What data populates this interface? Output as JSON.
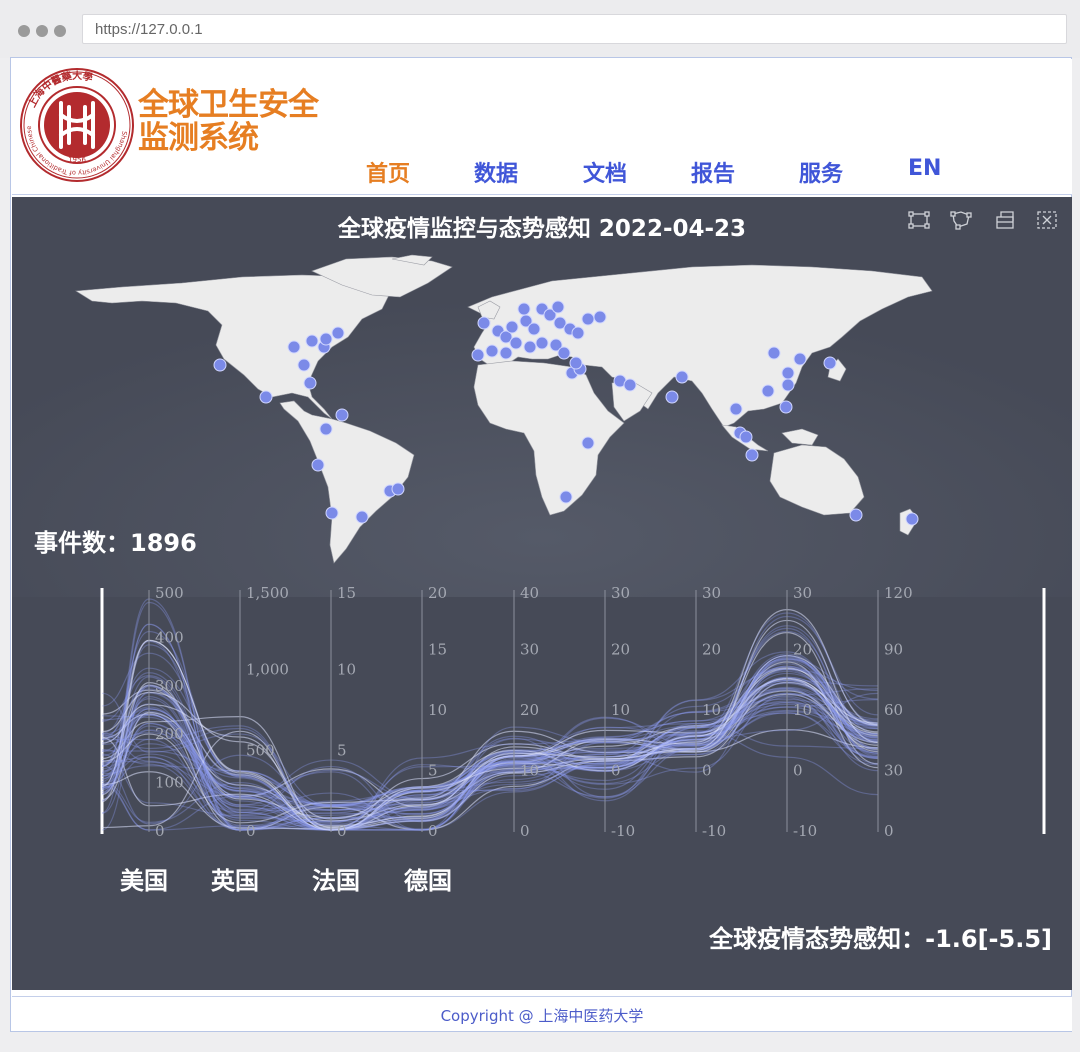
{
  "browser": {
    "url": "https://127.0.0.1"
  },
  "header": {
    "title_line1": "全球卫生安全",
    "title_line2": "监测系统",
    "logo": {
      "name": "university-seal",
      "year": "1956",
      "ring_text": "Shanghai University of Traditional Chinese Medicine",
      "cn_ring_text": "上海中醫藥大學"
    }
  },
  "nav": {
    "items": [
      {
        "label": "首页",
        "active": true
      },
      {
        "label": "数据",
        "active": false
      },
      {
        "label": "文档",
        "active": false
      },
      {
        "label": "报告",
        "active": false
      },
      {
        "label": "服务",
        "active": false
      },
      {
        "label": "EN",
        "active": false
      }
    ]
  },
  "dashboard": {
    "title": "全球疫情监控与态势感知 2022-04-23",
    "tools": [
      "rect-select-icon",
      "lasso-select-icon",
      "keep-selection-icon",
      "clear-selection-icon"
    ],
    "event_count_label": "事件数：",
    "event_count": "1896",
    "countries": [
      "美国",
      "英国",
      "法国",
      "德国"
    ],
    "situation_label": "全球疫情态势感知：",
    "situation_value": "-1.6[-5.5]"
  },
  "parallel_axes": [
    {
      "ticks": [
        "500",
        "400",
        "300",
        "200",
        "100",
        "0"
      ]
    },
    {
      "ticks": [
        "1,500",
        "1,000",
        "500",
        "0"
      ]
    },
    {
      "ticks": [
        "15",
        "10",
        "5",
        "0"
      ]
    },
    {
      "ticks": [
        "20",
        "15",
        "10",
        "5",
        "0"
      ]
    },
    {
      "ticks": [
        "40",
        "30",
        "20",
        "10",
        "0"
      ]
    },
    {
      "ticks": [
        "30",
        "20",
        "10",
        "0",
        "-10"
      ]
    },
    {
      "ticks": [
        "30",
        "20",
        "10",
        "0",
        "-10"
      ]
    },
    {
      "ticks": [
        "30",
        "20",
        "10",
        "0",
        "-10"
      ]
    },
    {
      "ticks": [
        "120",
        "90",
        "60",
        "30",
        "0"
      ]
    }
  ],
  "footer": {
    "text": "Copyright @ 上海中医药大学"
  },
  "colors": {
    "accent": "#e67e22",
    "nav": "#4056d8",
    "panel": "#464a57",
    "point": "#7b8ae8",
    "land": "#ececec"
  }
}
